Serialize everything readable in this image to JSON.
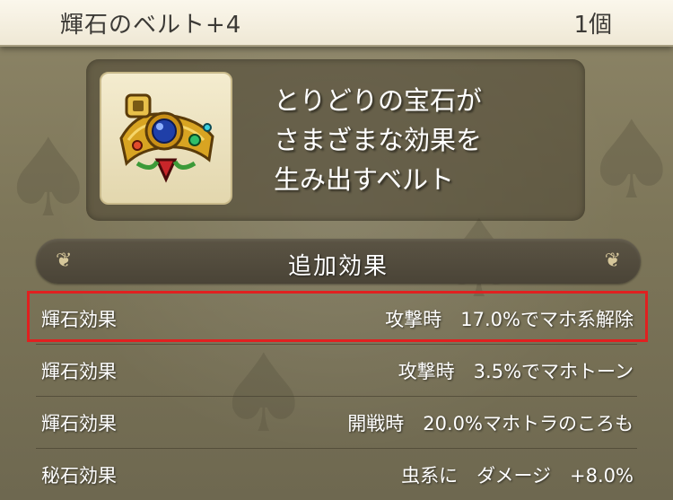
{
  "header": {
    "item_name": "輝石のベルト+4",
    "item_count": "1個"
  },
  "item": {
    "icon": "gem-belt-icon",
    "description_lines": [
      "とりどりの宝石が",
      "さまざまな効果を",
      "生み出すベルト"
    ]
  },
  "section": {
    "title": "追加効果"
  },
  "effects": [
    {
      "label": "輝石効果",
      "value": "攻撃時　17.0%でマホ系解除",
      "highlighted": true
    },
    {
      "label": "輝石効果",
      "value": "攻撃時　3.5%でマホトーン",
      "highlighted": false
    },
    {
      "label": "輝石効果",
      "value": "開戦時　20.0%マホトラのころも",
      "highlighted": false
    },
    {
      "label": "秘石効果",
      "value": "虫系に　ダメージ　+8.0%",
      "highlighted": false
    }
  ],
  "colors": {
    "highlight_border": "#e02020",
    "background": "#7d7659",
    "header_bg": "#f5f0e1"
  }
}
